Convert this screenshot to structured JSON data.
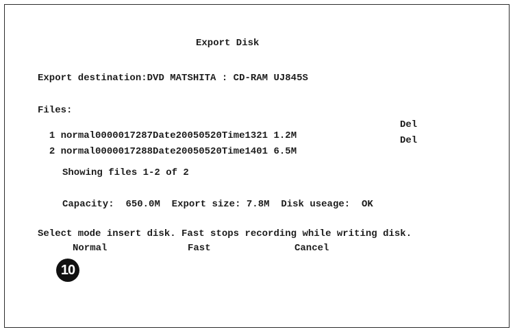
{
  "dialog": {
    "title": "Export Disk",
    "destination_label": "Export destination:",
    "destination_value": "DVD MATSHITA : CD-RAM UJ845S",
    "files_label": "Files:",
    "files": [
      {
        "index": "1",
        "name": "normal0000017287Date20050520Time1321",
        "size": "1.2M",
        "action": "Del"
      },
      {
        "index": "2",
        "name": "normal0000017288Date20050520Time1401",
        "size": "6.5M",
        "action": "Del"
      }
    ],
    "showing_text": "Showing files 1-2 of 2",
    "capacity_label": "Capacity:",
    "capacity_value": "650.0M",
    "export_size_label": "Export size:",
    "export_size_value": "7.8M",
    "disk_usage_label": "Disk useage:",
    "disk_usage_value": "OK",
    "select_message": "Select mode insert disk. Fast stops recording while writing disk.",
    "modes": {
      "normal": "Normal",
      "fast": "Fast",
      "cancel": "Cancel"
    },
    "callout_number": "10"
  },
  "colors": {
    "background": "#ffffff",
    "text": "#1c1c1c",
    "border": "#2a2a2a",
    "badge": "#111111"
  }
}
